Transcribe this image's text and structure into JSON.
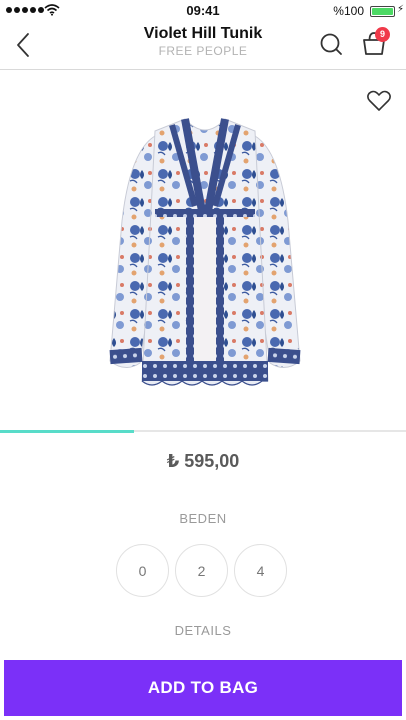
{
  "status_bar": {
    "time": "09:41",
    "battery_text": "%100",
    "battery_color": "#4cd964"
  },
  "header": {
    "back_icon": "chevron-left-icon",
    "title": "Violet Hill Tunik",
    "brand": "FREE PEOPLE",
    "search_icon": "search-icon",
    "cart_icon": "shopping-bag-icon",
    "cart_count": "9"
  },
  "product": {
    "image": "floral-tunic-image",
    "favorite_icon": "heart-icon",
    "gallery_progress": 0.33,
    "price": "₺ 595,00"
  },
  "size_section": {
    "label": "BEDEN",
    "options": [
      "0",
      "2",
      "4"
    ]
  },
  "details": {
    "label": "DETAILS"
  },
  "cta": {
    "label": "ADD TO BAG",
    "color": "#7b30f8"
  },
  "colors": {
    "accent_progress": "#58dcc9",
    "badge": "#f03a4a"
  }
}
